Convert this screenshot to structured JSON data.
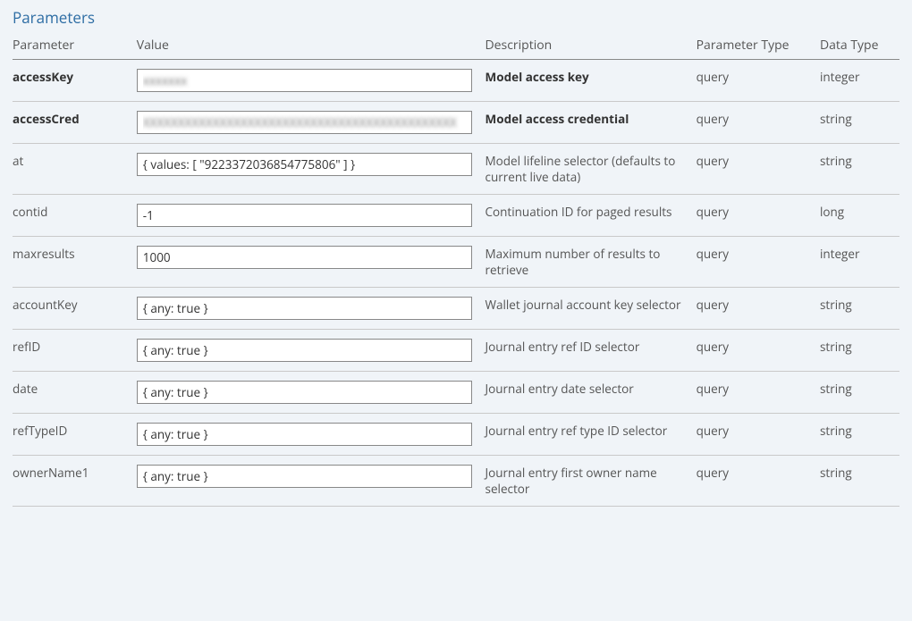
{
  "section_title": "Parameters",
  "columns": {
    "param": "Parameter",
    "value": "Value",
    "desc": "Description",
    "ptype": "Parameter Type",
    "dtype": "Data Type"
  },
  "rows": [
    {
      "name": "accessKey",
      "value": "xxxxxxx",
      "description": "Model access key",
      "param_type": "query",
      "data_type": "integer",
      "bold": true,
      "blurred": true
    },
    {
      "name": "accessCred",
      "value": "XXXXXXXXXXXXXXXXXXXXXXXXXXXXXXXXXXXXXXXXXXXXX",
      "description": "Model access credential",
      "param_type": "query",
      "data_type": "string",
      "bold": true,
      "blurred": true
    },
    {
      "name": "at",
      "value": "{ values: [ \"9223372036854775806\" ] }",
      "description": "Model lifeline selector (defaults to current live data)",
      "param_type": "query",
      "data_type": "string",
      "bold": false,
      "blurred": false
    },
    {
      "name": "contid",
      "value": "-1",
      "description": "Continuation ID for paged results",
      "param_type": "query",
      "data_type": "long",
      "bold": false,
      "blurred": false
    },
    {
      "name": "maxresults",
      "value": "1000",
      "description": "Maximum number of results to retrieve",
      "param_type": "query",
      "data_type": "integer",
      "bold": false,
      "blurred": false
    },
    {
      "name": "accountKey",
      "value": "{ any: true }",
      "description": "Wallet journal account key selector",
      "param_type": "query",
      "data_type": "string",
      "bold": false,
      "blurred": false
    },
    {
      "name": "refID",
      "value": "{ any: true }",
      "description": "Journal entry ref ID selector",
      "param_type": "query",
      "data_type": "string",
      "bold": false,
      "blurred": false
    },
    {
      "name": "date",
      "value": "{ any: true }",
      "description": "Journal entry date selector",
      "param_type": "query",
      "data_type": "string",
      "bold": false,
      "blurred": false
    },
    {
      "name": "refTypeID",
      "value": "{ any: true }",
      "description": "Journal entry ref type ID selector",
      "param_type": "query",
      "data_type": "string",
      "bold": false,
      "blurred": false
    },
    {
      "name": "ownerName1",
      "value": "{ any: true }",
      "description": "Journal entry first owner name selector",
      "param_type": "query",
      "data_type": "string",
      "bold": false,
      "blurred": false
    }
  ]
}
